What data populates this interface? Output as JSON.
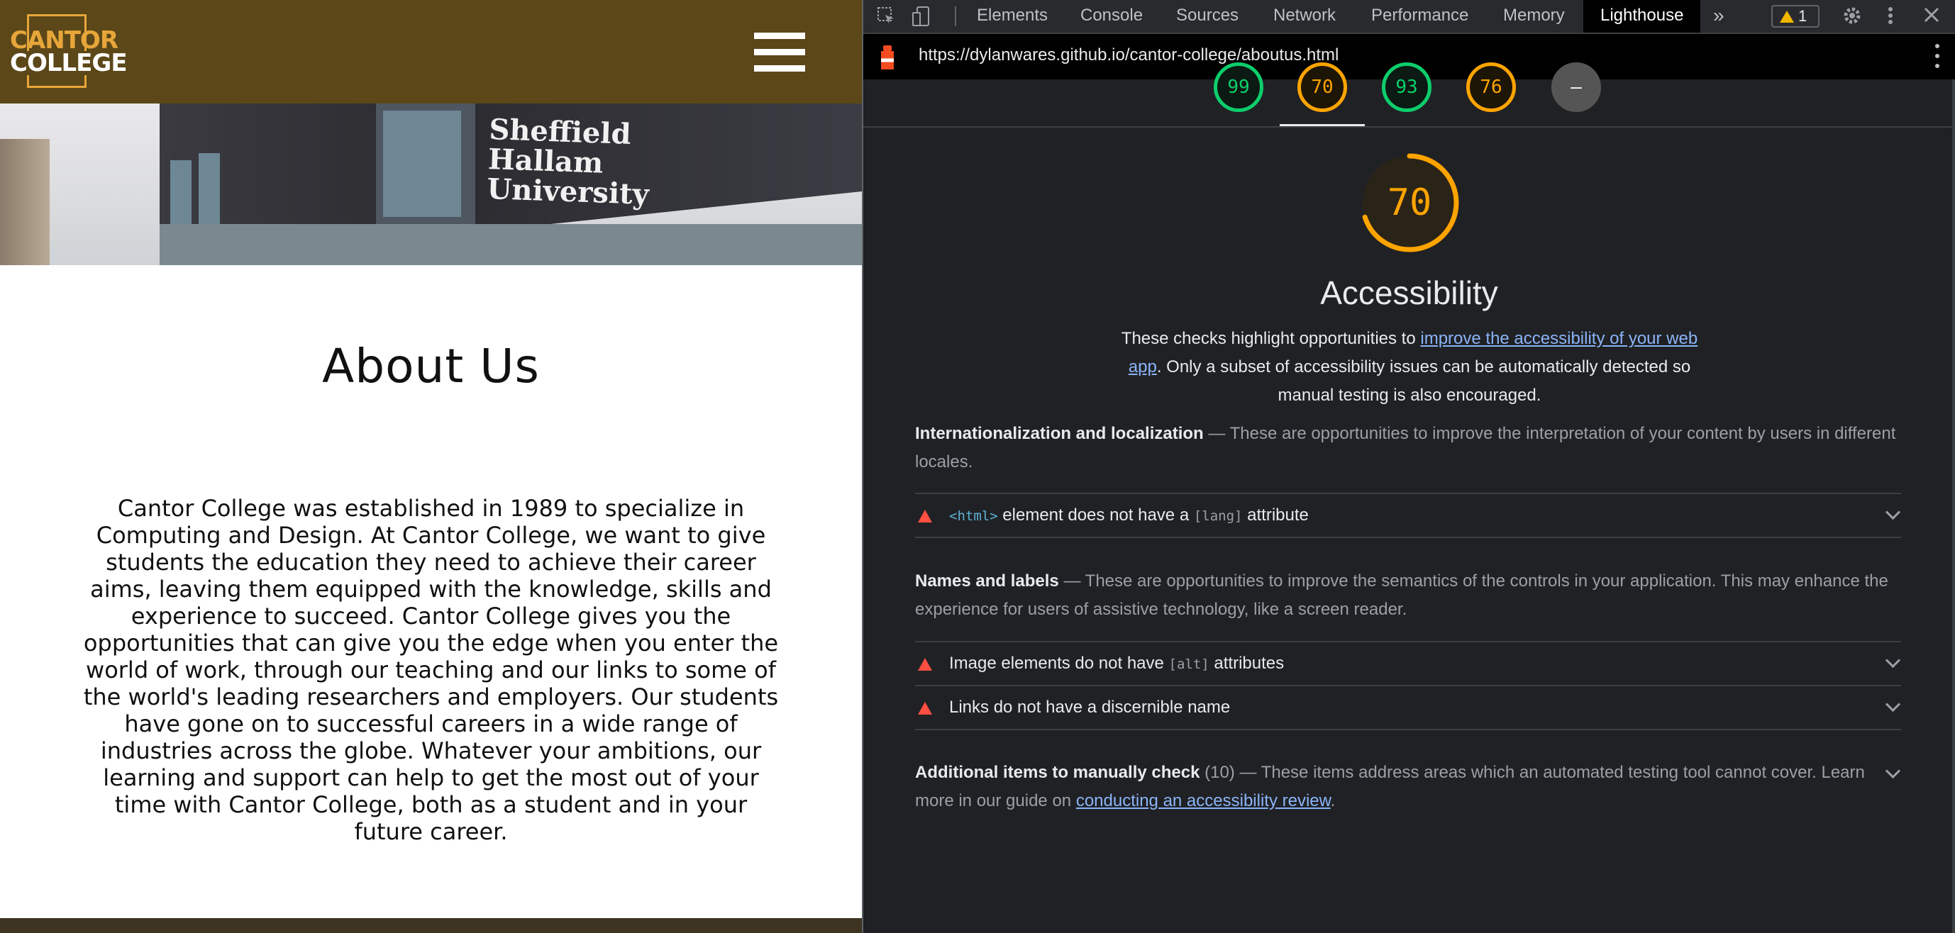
{
  "site": {
    "logo": {
      "line1": "CANTOR",
      "line2": "COLLEGE"
    },
    "banner_sign": [
      "Sheffield",
      "Hallam",
      "University"
    ],
    "title": "About Us",
    "body": "Cantor College was established in 1989 to specialize in Computing and Design. At Cantor College, we want to give students the education they need to achieve their career aims, leaving them equipped with the knowledge, skills and experience to succeed. Cantor College gives you the opportunities that can give you the edge when you enter the world of work, through our teaching and our links to some of the world's leading researchers and employers. Our students have gone on to successful careers in a wide range of industries across the globe. Whatever your ambitions, our learning and support can help to get the most out of your time with Cantor College, both as a student and in your future career."
  },
  "devtools": {
    "tabs": [
      "Elements",
      "Console",
      "Sources",
      "Network",
      "Performance",
      "Memory",
      "Lighthouse"
    ],
    "active_tab": "Lighthouse",
    "more_tabs": "»",
    "warnings": "1",
    "url": "https://dylanwares.github.io/cantor-college/aboutus.html",
    "gauges": [
      {
        "score": "99",
        "color": "#0cce6b"
      },
      {
        "score": "70",
        "color": "#ffa400"
      },
      {
        "score": "93",
        "color": "#0cce6b"
      },
      {
        "score": "76",
        "color": "#ffa400"
      },
      {
        "score": "–",
        "color": "#555555"
      }
    ],
    "category": {
      "score": 70,
      "score_label": "70",
      "title": "Accessibility",
      "desc_before": "These checks highlight opportunities to ",
      "desc_link": "improve the accessibility of your web app",
      "desc_after": ". Only a subset of accessibility issues can be automatically detected so manual testing is also encouraged."
    },
    "groups": [
      {
        "title": "Internationalization and localization",
        "desc": "These are opportunities to improve the interpretation of your content by users in different locales.",
        "audits": [
          {
            "code": "<html>",
            "text1": " element does not have a ",
            "code2": "[lang]",
            "text2": " attribute"
          }
        ]
      },
      {
        "title": "Names and labels",
        "desc": "These are opportunities to improve the semantics of the controls in your application. This may enhance the experience for users of assistive technology, like a screen reader.",
        "audits": [
          {
            "text1": "Image elements do not have ",
            "code2": "[alt]",
            "text2": " attributes"
          },
          {
            "text1": "Links do not have a discernible name"
          }
        ]
      }
    ],
    "manual": {
      "title": "Additional items to manually check",
      "count": "(10)",
      "desc": "These items address areas which an automated testing tool cannot cover. Learn more in our guide on ",
      "link": "conducting an accessibility review",
      "end": "."
    },
    "separator": "—"
  }
}
